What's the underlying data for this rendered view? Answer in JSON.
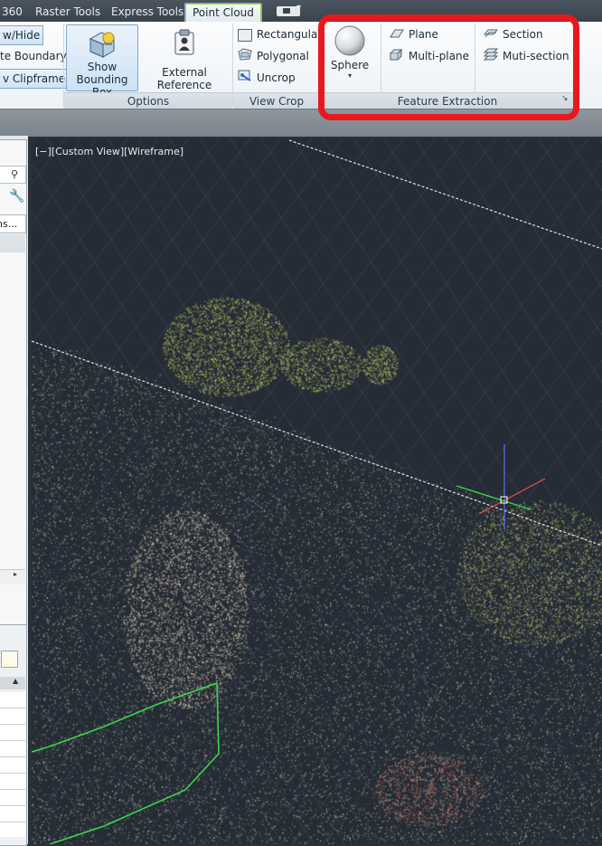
{
  "tabs": [
    "360",
    "Raster Tools",
    "Express Tools",
    "Point Cloud"
  ],
  "active_tab": "Point Cloud",
  "left_panel_buttons": [
    "w/Hide",
    "te Boundary",
    "v Clipframe"
  ],
  "options": {
    "show_bounding_box": "Show\nBounding Box",
    "show_line1": "Show",
    "show_line2": "Bounding Box",
    "external_reference": "External Reference",
    "title": "Options"
  },
  "view_crop": {
    "rectangular": "Rectangular",
    "polygonal": "Polygonal",
    "uncrop": "Uncrop",
    "title": "View Crop"
  },
  "feature_extraction": {
    "sphere": "Sphere",
    "plane": "Plane",
    "multi_plane": "Multi-plane",
    "section": "Section",
    "multi_section": "Muti-section",
    "title": "Feature Extraction"
  },
  "palette": {
    "tab_text": "ns..."
  },
  "viewport": {
    "label": "[−][Custom View][Wireframe]"
  },
  "colors": {
    "annotation": "#e8181f",
    "ribbon_accent": "#9ed24c",
    "boundary_line": "#39d84a"
  }
}
